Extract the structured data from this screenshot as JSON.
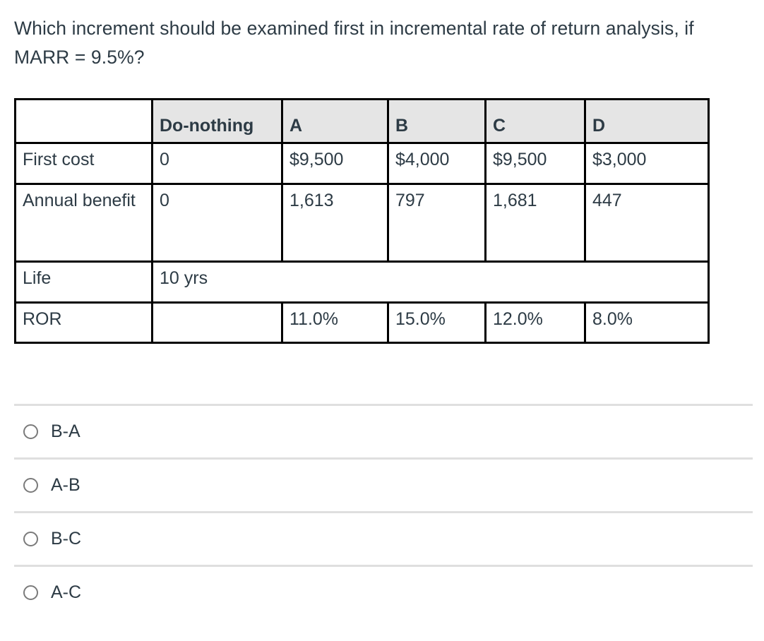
{
  "question": {
    "text": "Which increment should be examined first in incremental rate of return analysis, if MARR = 9.5%?"
  },
  "table": {
    "headers": [
      "",
      "Do-nothing",
      "A",
      "B",
      "C",
      "D"
    ],
    "rows": [
      {
        "label": "First cost",
        "cells": [
          "0",
          "$9,500",
          "$4,000",
          "$9,500",
          "$3,000"
        ]
      },
      {
        "label": "Annual benefit",
        "cells": [
          "0",
          "1,613",
          "797",
          "1,681",
          "447"
        ]
      },
      {
        "label": "Life",
        "merged_value": "10 yrs"
      },
      {
        "label": "ROR",
        "cells": [
          "",
          "11.0%",
          "15.0%",
          "12.0%",
          "8.0%"
        ]
      }
    ]
  },
  "answers": {
    "options": [
      {
        "label": "B-A",
        "selected": false
      },
      {
        "label": "A-B",
        "selected": false
      },
      {
        "label": "B-C",
        "selected": false
      },
      {
        "label": "A-C",
        "selected": false
      }
    ]
  },
  "colors": {
    "text": "#2d3b45",
    "header_background": "#e5e5e5",
    "table_border": "#000000",
    "divider": "#dfdfdf",
    "radio_border": "#7a7a7a"
  }
}
